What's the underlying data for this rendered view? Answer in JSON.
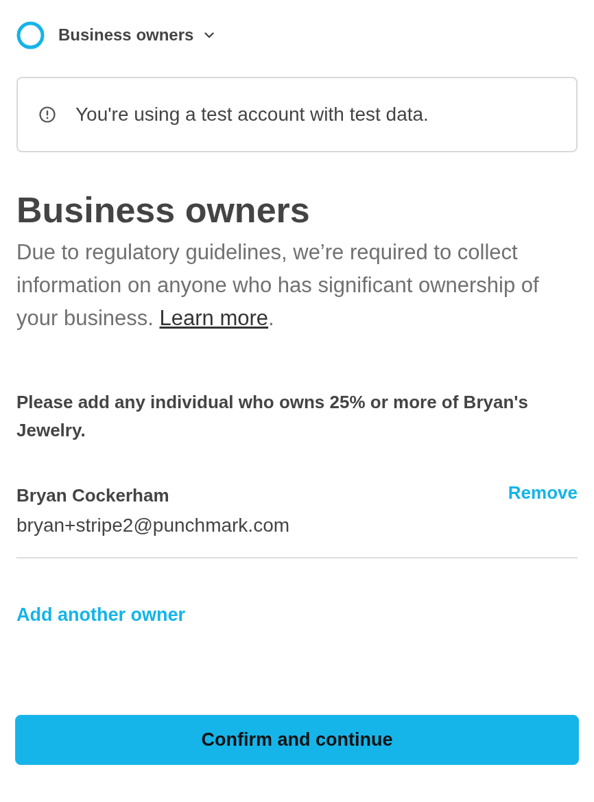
{
  "header": {
    "title": "Business owners"
  },
  "alert": {
    "text": "You're using a test account with test data."
  },
  "heading": "Business owners",
  "description": {
    "text": "Due to regulatory guidelines, we’re required to collect information on anyone who has significant ownership of your business. ",
    "link": "Learn more",
    "suffix": "."
  },
  "prompt": "Please add any individual who owns 25% or more of Bryan's Jewelry.",
  "owners": [
    {
      "name": "Bryan Cockerham",
      "email": "bryan+stripe2@punchmark.com",
      "action": "Remove"
    }
  ],
  "add_owner_link": "Add another owner",
  "primary_button": "Confirm and continue"
}
